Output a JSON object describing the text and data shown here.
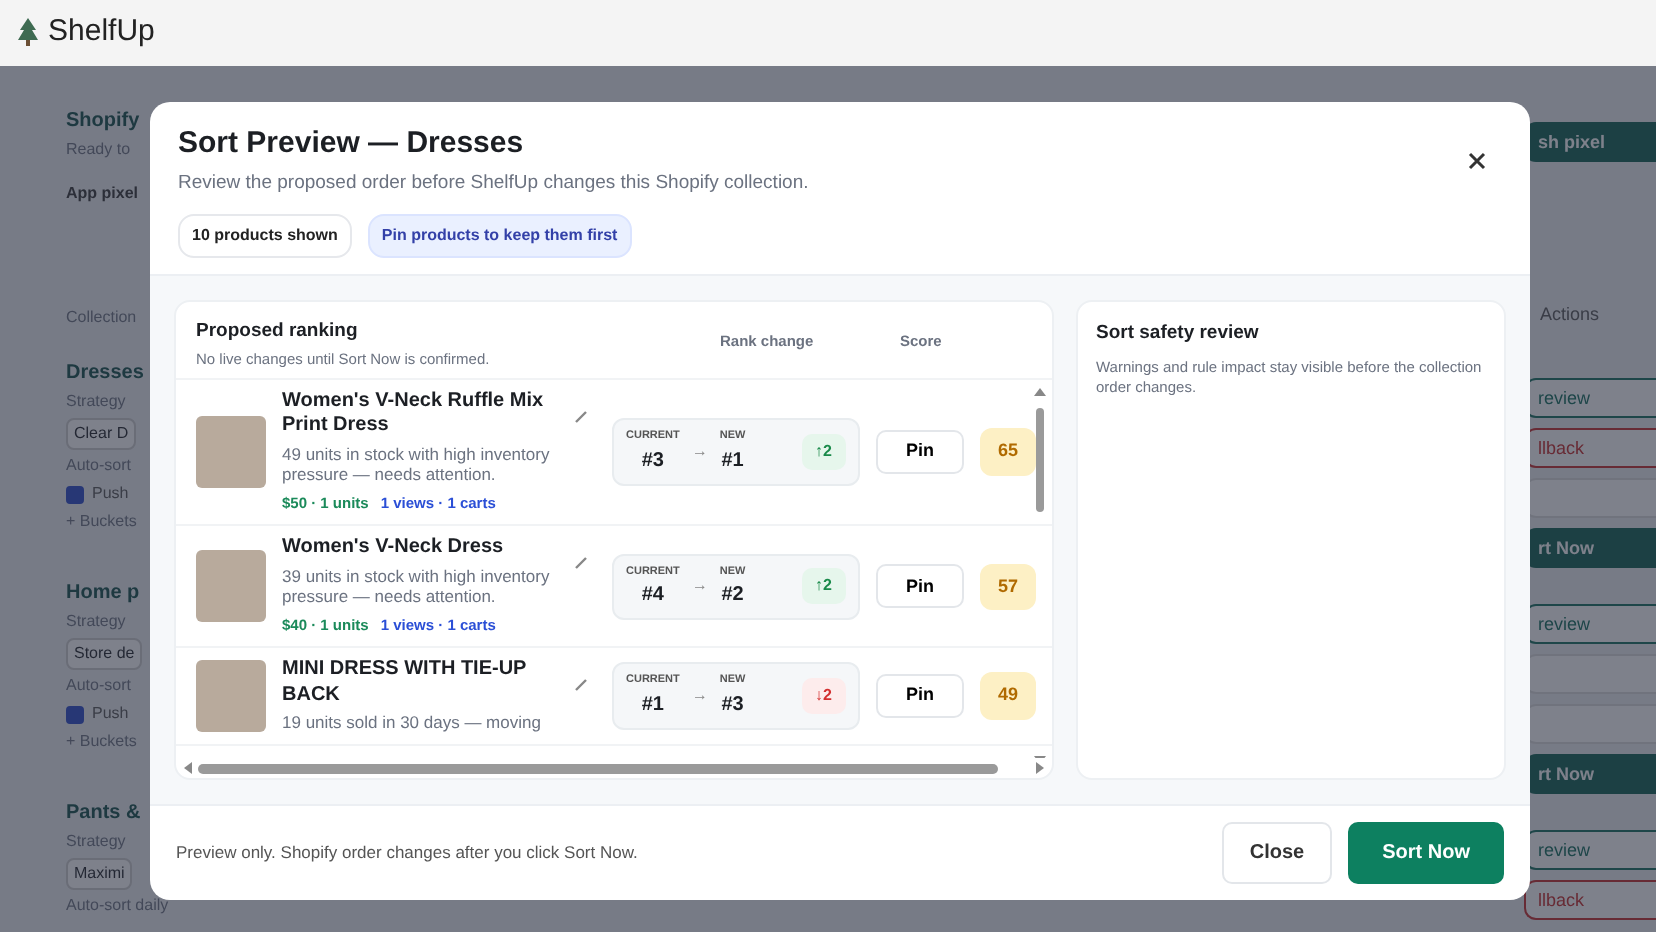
{
  "app": {
    "name": "ShelfUp"
  },
  "background": {
    "left_groups": [
      [
        {
          "kind": "title",
          "text": "Shopify"
        },
        {
          "kind": "muted",
          "text": "Ready to"
        },
        {
          "kind": "label",
          "text": "App pixel"
        }
      ],
      [
        {
          "kind": "muted",
          "text": "Collection"
        }
      ],
      [
        {
          "kind": "title",
          "text": "Dresses"
        },
        {
          "kind": "muted",
          "text": "Strategy"
        },
        {
          "kind": "field",
          "text": "Clear D"
        },
        {
          "kind": "muted",
          "text": "Auto-sort"
        },
        {
          "kind": "check",
          "text": "Push",
          "checked": true
        },
        {
          "kind": "muted",
          "text": "+ Buckets"
        }
      ],
      [
        {
          "kind": "title",
          "text": "Home p"
        },
        {
          "kind": "muted",
          "text": "Strategy"
        },
        {
          "kind": "field",
          "text": "Store de"
        },
        {
          "kind": "muted",
          "text": "Auto-sort"
        },
        {
          "kind": "check",
          "text": "Push",
          "checked": true
        },
        {
          "kind": "muted",
          "text": "+ Buckets"
        }
      ],
      [
        {
          "kind": "title",
          "text": "Pants &"
        },
        {
          "kind": "muted",
          "text": "Strategy"
        },
        {
          "kind": "field",
          "text": "Maximi"
        },
        {
          "kind": "muted",
          "text": "Auto-sort daily"
        }
      ]
    ],
    "right_groups": [
      [
        {
          "kind": "solid",
          "text": "sh pixel"
        }
      ],
      [
        {
          "kind": "header",
          "text": "Actions"
        }
      ],
      [
        {
          "kind": "outline",
          "text": "review"
        },
        {
          "kind": "danger",
          "text": "llback"
        },
        {
          "kind": "blank"
        },
        {
          "kind": "solid",
          "text": "rt Now"
        }
      ],
      [
        {
          "kind": "outline",
          "text": "review"
        },
        {
          "kind": "blank"
        },
        {
          "kind": "blank"
        },
        {
          "kind": "solid",
          "text": "rt Now"
        }
      ],
      [
        {
          "kind": "outline",
          "text": "review"
        },
        {
          "kind": "danger",
          "text": "llback"
        }
      ]
    ]
  },
  "modal": {
    "title": "Sort Preview — Dresses",
    "subtitle": "Review the proposed order before ShelfUp changes this Shopify collection.",
    "chips": [
      {
        "kind": "plain",
        "text": "10 products shown"
      },
      {
        "kind": "accent",
        "text": "Pin products to keep them first"
      }
    ],
    "ranking": {
      "title": "Proposed ranking",
      "subtitle": "No live changes until Sort Now is confirmed.",
      "columns": [
        "Rank change",
        "Score"
      ],
      "rows": [
        {
          "name": "Women's V-Neck Ruffle Mix Print Dress",
          "description": "49 units in stock with high inventory pressure — needs attention.",
          "price_units": "$50 · 1 units",
          "views_carts": "1 views · 1 carts",
          "current_label": "CURRENT",
          "current": "#3",
          "arrow": "→",
          "new_label": "NEW",
          "new": "#1",
          "kind": "rise",
          "delta": "↑2",
          "pin": "Pin",
          "score": "65"
        },
        {
          "name": "Women's V-Neck Dress",
          "description": "39 units in stock with high inventory pressure — needs attention.",
          "price_units": "$40 · 1 units",
          "views_carts": "1 views · 1 carts",
          "current_label": "CURRENT",
          "current": "#4",
          "arrow": "→",
          "new_label": "NEW",
          "new": "#2",
          "kind": "rise",
          "delta": "↑2",
          "pin": "Pin",
          "score": "57"
        },
        {
          "name": "MINI DRESS WITH TIE-UP BACK",
          "description": "19 units sold in 30 days — moving",
          "current_label": "CURRENT",
          "current": "#1",
          "arrow": "→",
          "new_label": "NEW",
          "new": "#3",
          "kind": "drop",
          "delta": "↓2",
          "pin": "Pin",
          "score": "49"
        }
      ]
    },
    "safety": {
      "title": "Sort safety review",
      "text": "Warnings and rule impact stay visible before the collection order changes."
    },
    "footer_note": "Preview only. Shopify order changes after you click Sort Now.",
    "buttons": [
      {
        "kind": "secondary",
        "text": "Close"
      },
      {
        "kind": "primary",
        "text": "Sort Now"
      }
    ]
  }
}
